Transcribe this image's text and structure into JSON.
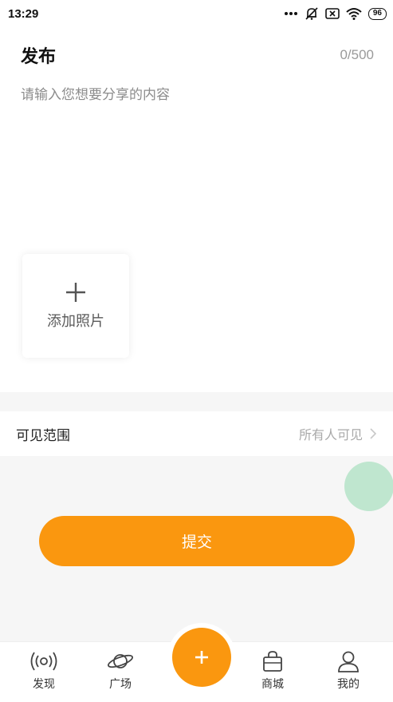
{
  "status_bar": {
    "time": "13:29",
    "battery": "96",
    "icons": [
      "more-dots-icon",
      "bell-off-icon",
      "sim-x-icon",
      "wifi-icon",
      "battery-icon"
    ]
  },
  "header": {
    "title": "发布",
    "char_count": "0/500"
  },
  "content": {
    "placeholder": "请输入您想要分享的内容",
    "value": ""
  },
  "add_photo": {
    "label": "添加照片",
    "icon": "plus-icon"
  },
  "visibility": {
    "label": "可见范围",
    "value": "所有人可见",
    "icon": "chevron-right-icon"
  },
  "submit": {
    "label": "提交"
  },
  "tab_bar": {
    "items": [
      {
        "label": "发现",
        "icon": "broadcast-icon"
      },
      {
        "label": "广场",
        "icon": "planet-icon"
      },
      {
        "label": "",
        "icon": "plus-icon"
      },
      {
        "label": "商城",
        "icon": "shopping-bag-icon"
      },
      {
        "label": "我的",
        "icon": "user-icon"
      }
    ]
  },
  "colors": {
    "accent": "#fa970f",
    "floating_circle": "#bfe6cf",
    "background_gray": "#f6f6f6",
    "muted_text": "#a9a9a9"
  }
}
